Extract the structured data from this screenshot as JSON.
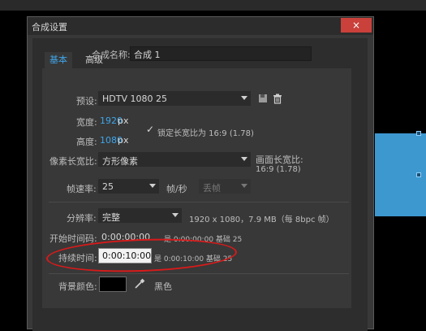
{
  "dialog": {
    "title": "合成设置",
    "close_icon": "×",
    "comp_name_label": "合成名称:",
    "comp_name_value": "合成 1"
  },
  "tabs": [
    {
      "label": "基本",
      "active": true
    },
    {
      "label": "高级",
      "active": false
    }
  ],
  "basic": {
    "preset_label": "预设:",
    "preset_value": "HDTV 1080 25",
    "width_label": "宽度:",
    "width_value": "1920",
    "width_unit": "px",
    "height_label": "高度:",
    "height_value": "1080",
    "height_unit": "px",
    "lock_check": "✓",
    "lock_label": "锁定长宽比为 16:9 (1.78)",
    "pixel_aspect_label": "像素长宽比:",
    "pixel_aspect_value": "方形像素",
    "frame_aspect_label": "画面长宽比:",
    "frame_aspect_value": "16:9 (1.78)",
    "frame_rate_label": "帧速率:",
    "frame_rate_value": "25",
    "frame_rate_unit": "帧/秒",
    "drop_frame_value": "丢帧",
    "resolution_label": "分辨率:",
    "resolution_value": "完整",
    "resolution_info": "1920 x 1080，7.9 MB（每 8bpc 帧）",
    "start_timecode_label": "开始时间码:",
    "start_timecode_value": "0:00:00:00",
    "start_timecode_info": "是 0:00:00:00 基础 25",
    "duration_label": "持续时间:",
    "duration_value": "0:00:10:00",
    "duration_info": "是 0:00:10:00 基础 25",
    "bg_color_label": "背景颜色:",
    "bg_color_name": "黑色"
  },
  "colors": {
    "accent": "#3fa5e8",
    "dialog_bg": "#383838",
    "close_button": "#c9413a",
    "highlight_circle": "#d91a1a",
    "bg_color_swatch": "#000000",
    "comp_preview": "#3d98d0"
  },
  "icons": {
    "save_preset": "save-icon",
    "delete_preset": "trash-icon",
    "eyedropper": "eyedropper-icon"
  }
}
